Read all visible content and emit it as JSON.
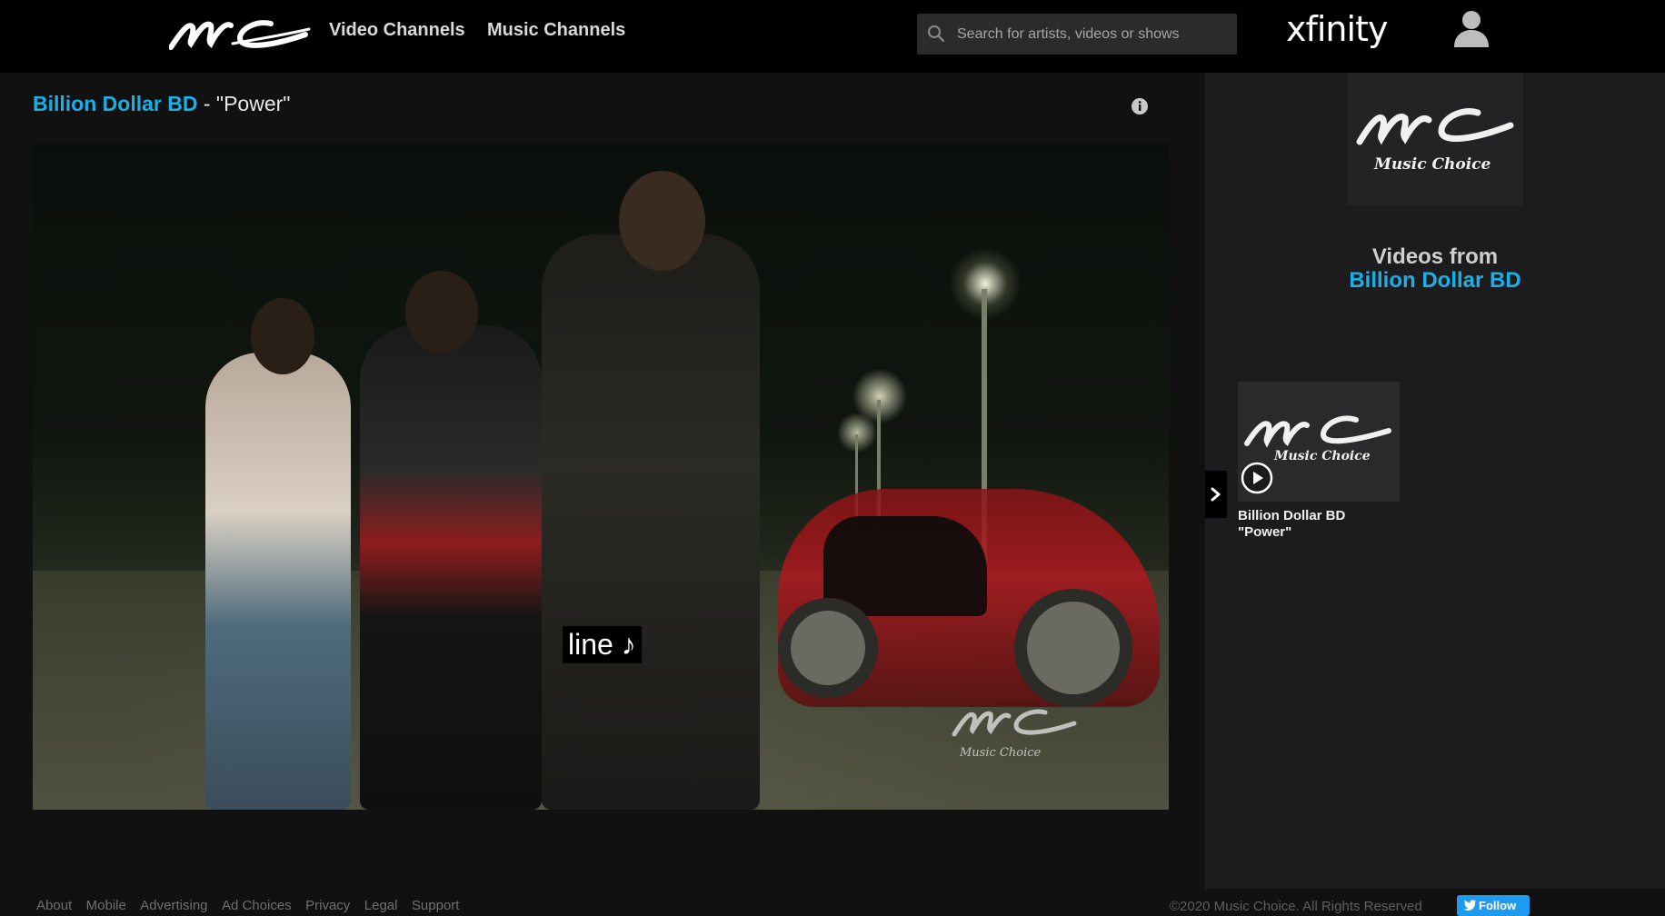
{
  "header": {
    "nav": [
      {
        "label": "Video Channels"
      },
      {
        "label": "Music Channels"
      }
    ],
    "search": {
      "placeholder": "Search for artists, videos or shows",
      "value": ""
    },
    "partner_logo": "xfinity"
  },
  "player": {
    "artist": "Billion Dollar BD",
    "separator": " - ",
    "song": "\"Power\"",
    "subtitle": "line ♪"
  },
  "sidebar": {
    "videos_from_label": "Videos from",
    "artist": "Billion Dollar BD",
    "items": [
      {
        "artist": "Billion Dollar BD",
        "title": "\"Power\""
      }
    ]
  },
  "footer": {
    "links": [
      "About",
      "Mobile",
      "Advertising",
      "Ad Choices",
      "Privacy",
      "Legal",
      "Support"
    ],
    "copyright": "©2020 Music Choice. All Rights Reserved",
    "follow_label": "Follow"
  },
  "colors": {
    "accent": "#1ab0e6",
    "header_bg": "#000000",
    "page_bg": "#111112",
    "twitter": "#1d9bf0"
  },
  "icons": {
    "logo": "music-choice-logo",
    "search": "search-icon",
    "user": "user-icon",
    "info": "info-icon",
    "arrow": "chevron-right-icon",
    "play": "play-icon",
    "twitter": "twitter-bird-icon"
  }
}
